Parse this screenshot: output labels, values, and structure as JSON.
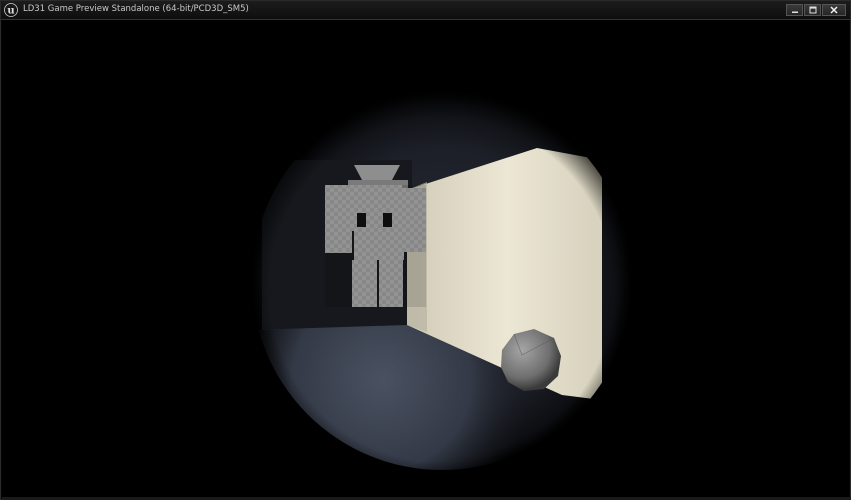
{
  "window": {
    "title": "LD31 Game Preview Standalone (64-bit/PCD3D_SM5)",
    "app_icon": "unreal-engine-logo-icon",
    "controls": {
      "minimize_icon": "minimize-icon",
      "maximize_icon": "maximize-icon",
      "close_icon": "close-icon"
    }
  },
  "scene": {
    "description_icons": [
      "flashlight-cone",
      "corridor-wall",
      "humanoid-figure",
      "boulder"
    ],
    "colors": {
      "light": "#e9e4d0",
      "floor": "#3b4150",
      "darkness": "#000000",
      "figure": "#9c9c9c",
      "boulder": "#7c7c7c"
    }
  }
}
